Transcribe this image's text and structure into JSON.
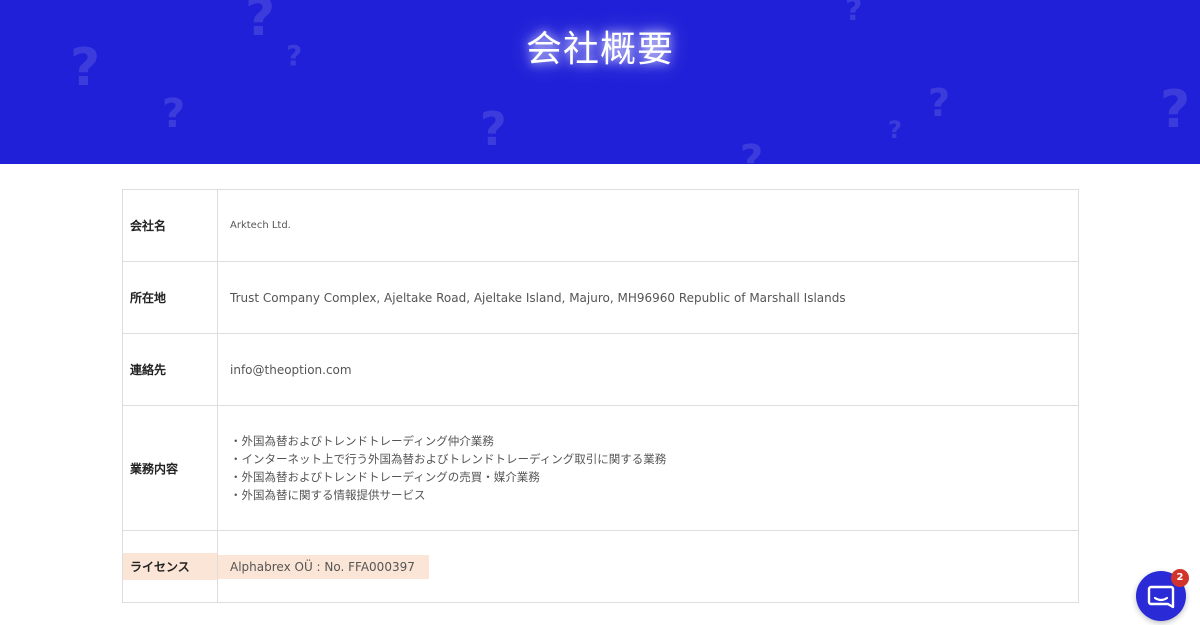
{
  "header": {
    "title": "会社概要",
    "background_color": "#2020d8"
  },
  "company_table": {
    "rows": [
      {
        "label": "会社名",
        "value": "Arktech Ltd."
      },
      {
        "label": "所在地",
        "value": "Trust Company Complex, Ajeltake Road, Ajeltake Island, Majuro, MH96960 Republic of Marshall Islands"
      },
      {
        "label": "連絡先",
        "value": "info@theoption.com"
      },
      {
        "label": "業務内容",
        "items": [
          "・外国為替およびトレンドトレーディング仲介業務",
          "・インターネット上で行う外国為替およびトレンドトレーディング取引に関する業務",
          "・外国為替およびトレンドトレーディングの売買・媒介業務",
          "・外国為替に関する情報提供サービス"
        ]
      },
      {
        "label": "ライセンス",
        "value": "Alphabrex OÜ : No. FFA000397",
        "highlight_color": "#fbe5d6"
      }
    ]
  },
  "chat_widget": {
    "icon": "chat-icon",
    "badge_count": "2",
    "button_color": "#2a2ad6",
    "badge_color": "#d0342c"
  }
}
